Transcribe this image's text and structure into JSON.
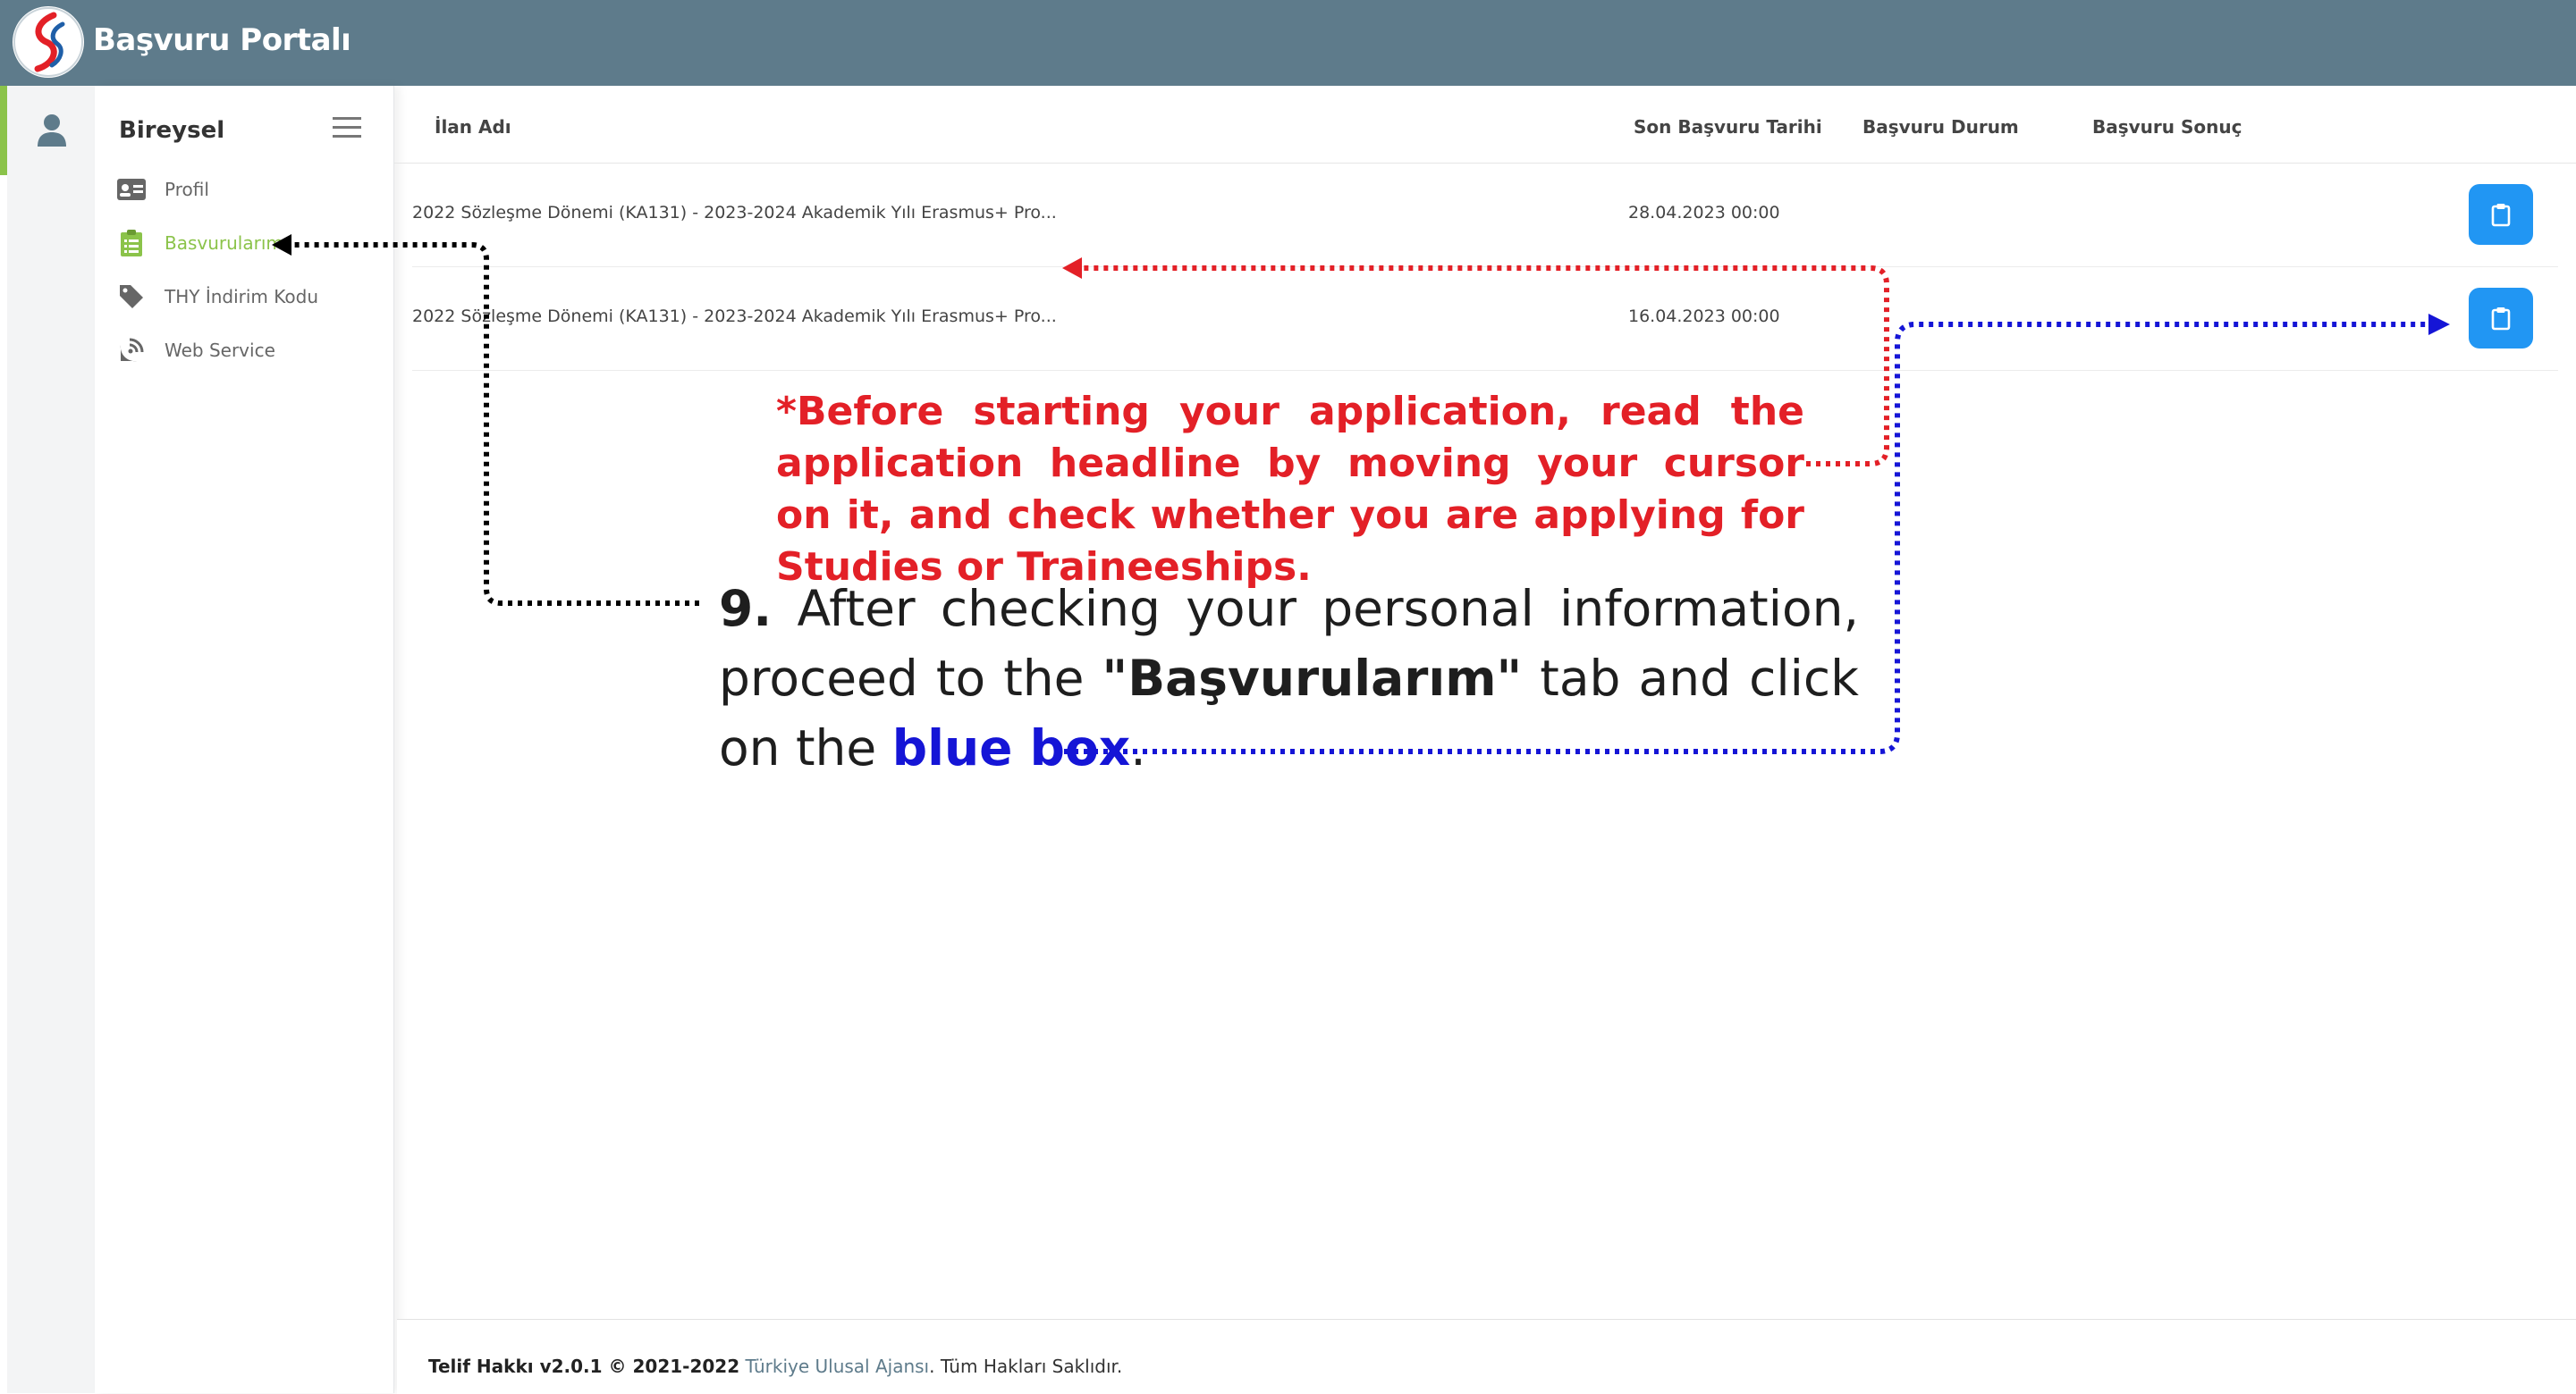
{
  "header": {
    "app_title": "Başvuru Portalı"
  },
  "sidebar": {
    "heading": "Bireysel",
    "items": [
      {
        "label": "Profil",
        "icon": "id-card-icon",
        "active": false
      },
      {
        "label": "Basvurularım",
        "icon": "clipboard-icon",
        "active": true
      },
      {
        "label": "THY İndirim Kodu",
        "icon": "tag-icon",
        "active": false
      },
      {
        "label": "Web Service",
        "icon": "satellite-dish-icon",
        "active": false
      }
    ]
  },
  "table": {
    "columns": [
      "İlan Adı",
      "Son Başvuru Tarihi",
      "Başvuru Durum",
      "Başvuru Sonuç"
    ],
    "rows": [
      {
        "title": "2022 Sözleşme Dönemi (KA131) - 2023-2024 Akademik Yılı Erasmus+ Pro...",
        "deadline": "28.04.2023 00:00",
        "status": "",
        "result": ""
      },
      {
        "title": "2022 Sözleşme Dönemi (KA131) - 2023-2024 Akademik Yılı Erasmus+ Pro...",
        "deadline": "16.04.2023 00:00",
        "status": "",
        "result": ""
      }
    ]
  },
  "footer": {
    "copyright_bold": "Telif Hakkı v2.0.1 © 2021-2022",
    "agency": "Türkiye Ulusal Ajansı",
    "rights": ". Tüm Hakları Saklıdır."
  },
  "annotations": {
    "red_note": "*Before starting your application, read the application headline by moving your cursor on it, and check whether you are applying for Studies or Traineeships.",
    "step_number": "9.",
    "step_text_1": " After checking your personal information, proceed to the ",
    "step_tab_name": "\"Başvurularım\"",
    "step_text_2": " tab and click on the ",
    "step_blue": "blue box",
    "step_end": "."
  },
  "colors": {
    "header_bg": "#5e7b8b",
    "active_green": "#8bc34a",
    "action_blue": "#2196f3",
    "note_red": "#e32027",
    "arrow_blue": "#1515d6"
  }
}
